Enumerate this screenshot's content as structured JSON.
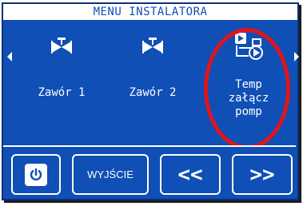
{
  "title": "MENU INSTALATORA",
  "items": [
    {
      "label_lines": [
        "Zawór 1"
      ],
      "icon": "valve-icon"
    },
    {
      "label_lines": [
        "Zawór 2"
      ],
      "icon": "valve-icon"
    },
    {
      "label_lines": [
        "Temp",
        "załącz",
        "pomp"
      ],
      "icon": "pump-temperature-icon"
    }
  ],
  "buttons": {
    "power": "power-icon",
    "exit": "WYJŚCIE",
    "prev": "<<",
    "next": ">>"
  },
  "colors": {
    "screen_bg": "#0f4fb6",
    "highlight": "#e0141e",
    "text": "#ffffff"
  }
}
